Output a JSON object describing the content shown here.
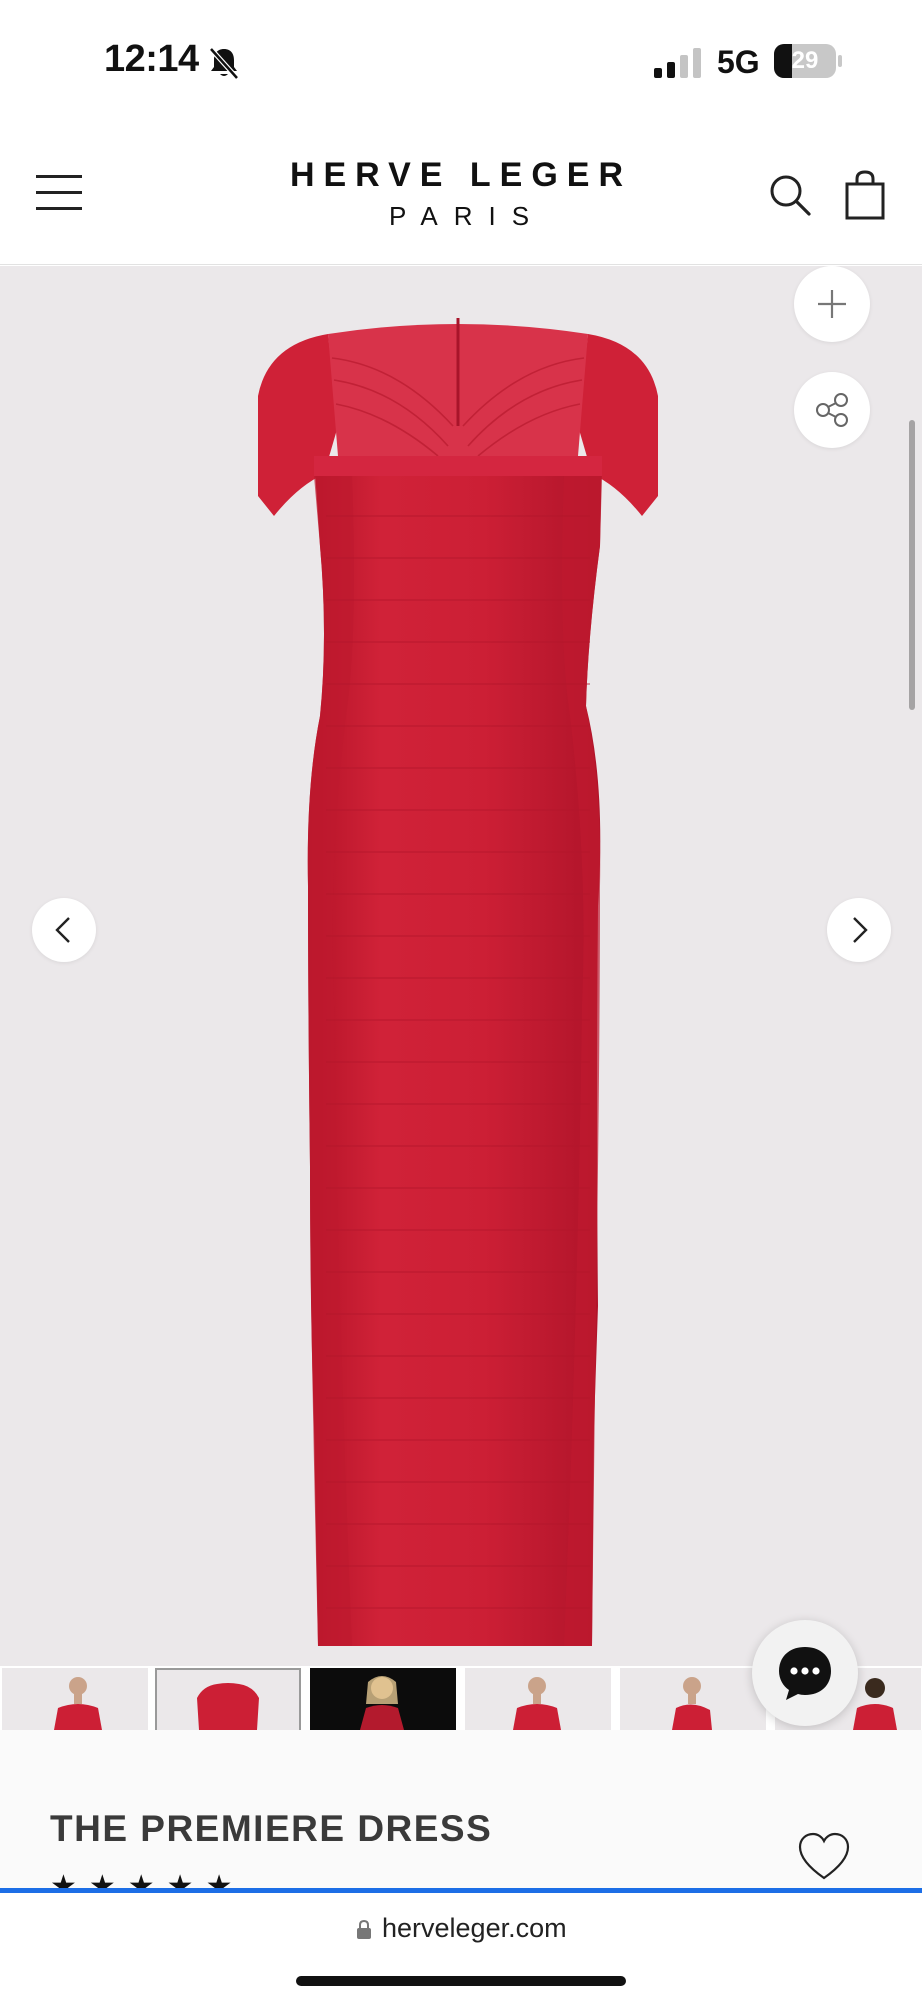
{
  "status_bar": {
    "time": "12:14",
    "network": "5G",
    "battery": "29",
    "battery_level": 0.29
  },
  "header": {
    "brand_line1": "HERVE LEGER",
    "brand_line2": "PARIS"
  },
  "gallery": {
    "background_color": "#ebe8ea",
    "dress_color": "#cc1f35",
    "thumbnails": [
      {
        "type": "model-front"
      },
      {
        "type": "dress",
        "selected": true
      },
      {
        "type": "model-dark-bg"
      },
      {
        "type": "model-front"
      },
      {
        "type": "model-side"
      },
      {
        "type": "model-back"
      }
    ]
  },
  "product": {
    "name": "THE PREMIERE DRESS",
    "stars": "★★★★★",
    "rating_stars_shown": 5
  },
  "browser": {
    "url": "herveleger.com",
    "accent_color": "#1c6ee6"
  }
}
